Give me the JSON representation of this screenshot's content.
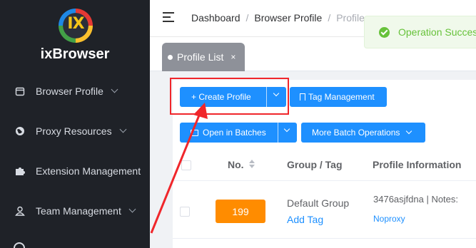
{
  "app": {
    "brand": "ixBrowser",
    "logo_text": "IX"
  },
  "sidebar": {
    "items": [
      {
        "label": "Browser Profile",
        "icon": "calendar-icon",
        "has_chevron": true
      },
      {
        "label": "Proxy Resources",
        "icon": "globe-icon",
        "has_chevron": true
      },
      {
        "label": "Extension Management",
        "icon": "puzzle-icon",
        "has_chevron": false
      },
      {
        "label": "Team Management",
        "icon": "user-icon",
        "has_chevron": true
      }
    ]
  },
  "header": {
    "breadcrumb": [
      "Dashboard",
      "Browser Profile",
      "Profile"
    ]
  },
  "tabs": [
    {
      "label": "Profile List",
      "close": "×"
    }
  ],
  "toast": {
    "message": "Operation Success",
    "color": "#67c23a"
  },
  "toolbar": {
    "create_profile": "+ Create Profile",
    "tag_management": "Tag Management",
    "open_in_batches": "Open in Batches",
    "more_batch_operations": "More Batch Operations"
  },
  "table": {
    "columns": [
      "No.",
      "Group / Tag",
      "Profile Information"
    ],
    "rows": [
      {
        "no": "199",
        "group": "Default Group",
        "add_tag": "Add Tag",
        "profile_info": "3476asjfdna | Notes:",
        "proxy": "Noproxy"
      }
    ]
  },
  "colors": {
    "primary": "#1e90ff",
    "sidebar_bg": "#1f2228",
    "badge": "#ff8c00",
    "highlight": "#f0262b"
  }
}
